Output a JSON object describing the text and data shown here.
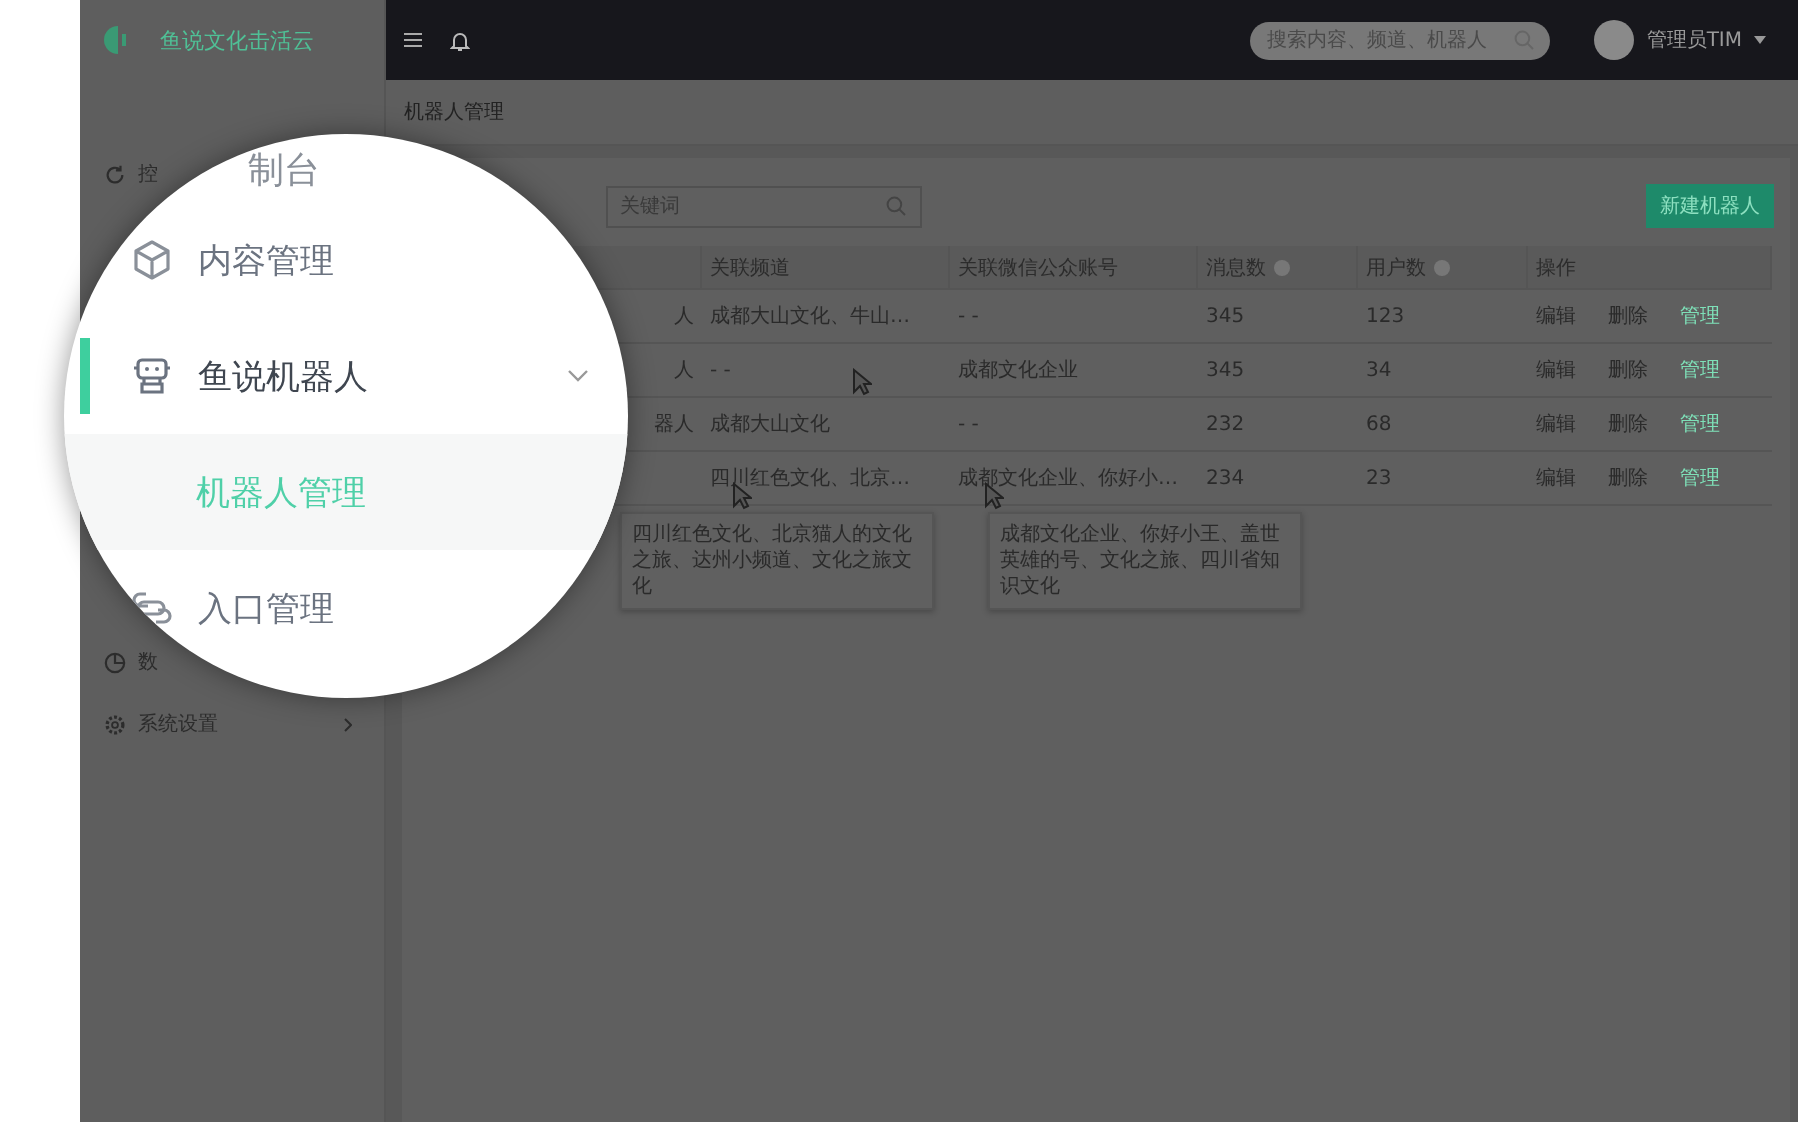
{
  "sidebar": {
    "logo_text": "鱼说文化击活云",
    "items": [
      {
        "label": "控",
        "kind": "dashboard",
        "expandable": false
      },
      {
        "label": "数",
        "kind": "stats",
        "expandable": false
      },
      {
        "label": "系统设置",
        "kind": "settings",
        "expandable": true
      }
    ]
  },
  "topbar": {
    "search": {
      "placeholder": "搜索内容、频道、机器人"
    },
    "user": "管理员TIM"
  },
  "breadcrumb": "机器人管理",
  "filter": {
    "placeholder": "关键词"
  },
  "new_button": "新建机器人",
  "table": {
    "columns": [
      {
        "label": "关联频道",
        "help": false
      },
      {
        "label": "关联微信公众账号",
        "help": false
      },
      {
        "label": "消息数",
        "help": true
      },
      {
        "label": "用户数",
        "help": true
      },
      {
        "label": "操作",
        "help": false
      }
    ],
    "rows": [
      {
        "column_1": "人",
        "channels": "成都大山文化、牛山…",
        "accounts": "- -",
        "messages": "345",
        "users": "123",
        "actions": [
          {
            "label": "编辑",
            "kind": "plain"
          },
          {
            "label": "删除",
            "kind": "plain"
          },
          {
            "label": "管理",
            "kind": "accent"
          }
        ]
      },
      {
        "column_1": "人",
        "channels": "- -",
        "accounts": "成都文化企业",
        "messages": "345",
        "users": "34",
        "actions": [
          {
            "label": "编辑",
            "kind": "plain"
          },
          {
            "label": "删除",
            "kind": "plain"
          },
          {
            "label": "管理",
            "kind": "accent"
          }
        ]
      },
      {
        "column_1": "器人",
        "channels": "成都大山文化",
        "accounts": "- -",
        "messages": "232",
        "users": "68",
        "actions": [
          {
            "label": "编辑",
            "kind": "plain"
          },
          {
            "label": "删除",
            "kind": "plain"
          },
          {
            "label": "管理",
            "kind": "accent"
          }
        ]
      },
      {
        "channels": "四川红色文化、北京…",
        "accounts": "成都文化企业、你好小…",
        "messages": "234",
        "users": "23",
        "actions": [
          {
            "label": "编辑",
            "kind": "plain"
          },
          {
            "label": "删除",
            "kind": "plain"
          },
          {
            "label": "管理",
            "kind": "accent"
          }
        ]
      }
    ]
  },
  "tooltips": [
    "四川红色文化、北京猫人的文化之旅、达州小频道、文化之旅文化",
    "成都文化企业、你好小王、盖世英雄的号、文化之旅、四川省知识文化"
  ],
  "magnifier": {
    "top_text": "制台",
    "items": [
      {
        "label": "内容管理",
        "kind": "content",
        "selected": false
      },
      {
        "label": "鱼说机器人",
        "kind": "robot",
        "selected": true,
        "expanded": true
      },
      {
        "label": "机器人管理",
        "kind": "submenu",
        "selected": true
      },
      {
        "label": "入口管理",
        "kind": "entry",
        "selected": false
      }
    ]
  }
}
